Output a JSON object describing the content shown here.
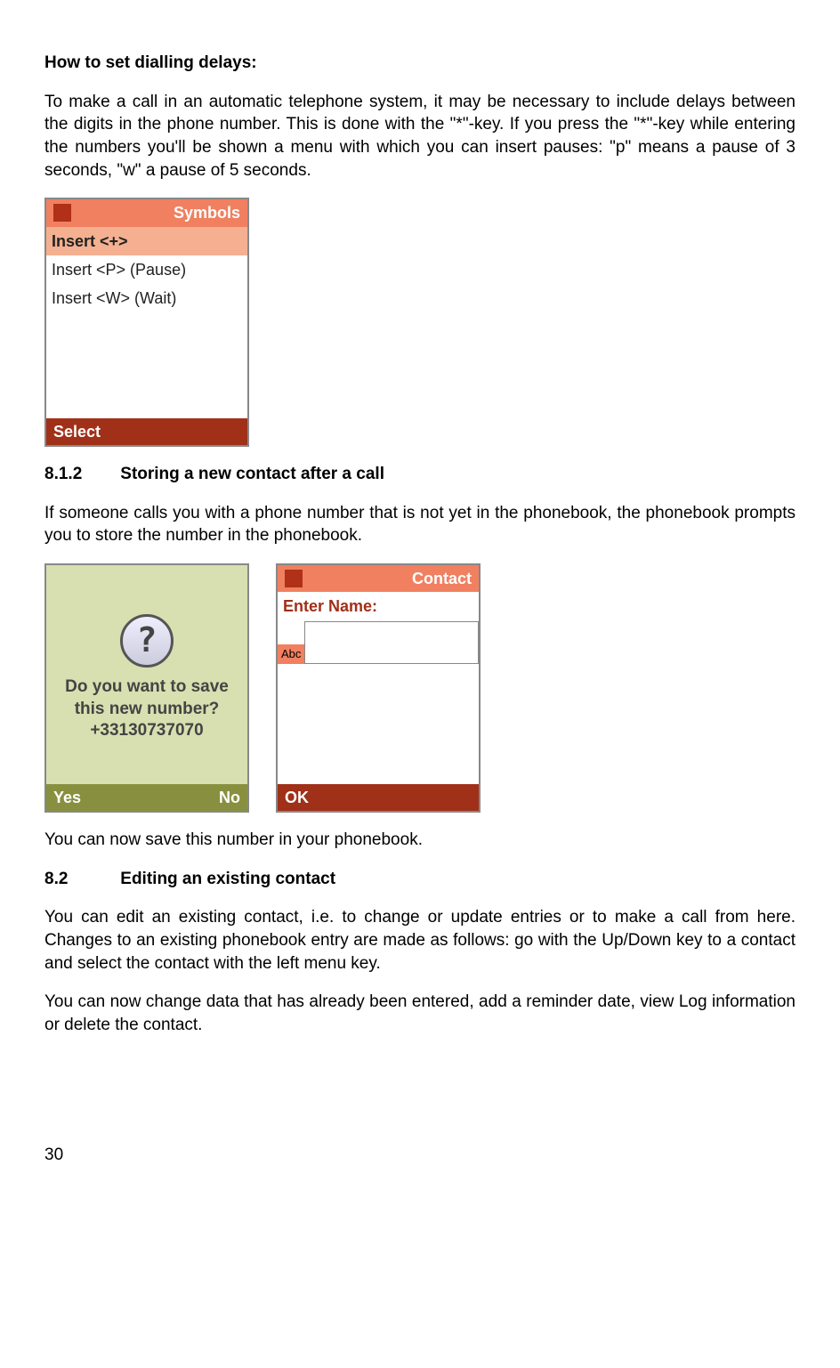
{
  "title1": "How to set dialling delays:",
  "para1": "To make a call in an automatic telephone system, it may be necessary to include delays between the digits in the phone number. This is done with the \"*\"-key. If you press the \"*\"-key while entering the numbers you'll be shown a menu with which you can insert pauses: \"p\" means a pause of 3 seconds, \"w\" a pause of 5 seconds.",
  "screen1": {
    "header": "Symbols",
    "items": [
      "Insert <+>",
      "Insert <P> (Pause)",
      "Insert <W> (Wait)"
    ],
    "footer_left": "Select"
  },
  "heading812_num": "8.1.2",
  "heading812_text": "Storing a new contact after a call",
  "para2": "If someone calls you with a phone number that is not yet in the phonebook, the phonebook prompts you to store the number in the phonebook.",
  "screen_prompt": {
    "line1": "Do you want to save",
    "line2": "this new number?",
    "number": "+33130737070",
    "yes": "Yes",
    "no": "No"
  },
  "screen_contact": {
    "header": "Contact",
    "label": "Enter Name:",
    "badge": "Abc",
    "ok": "OK"
  },
  "para3": "You can now save this number in your phonebook.",
  "heading82_num": "8.2",
  "heading82_text": "Editing an existing contact",
  "para4": "You can edit an existing contact, i.e. to change or update entries or to make a call from here. Changes to an existing phonebook entry are made as follows: go with the Up/Down key to a contact and select the contact with the left menu key.",
  "para5": "You can now change data that has already been entered, add a reminder date, view Log information or delete the contact.",
  "page_number": "30"
}
